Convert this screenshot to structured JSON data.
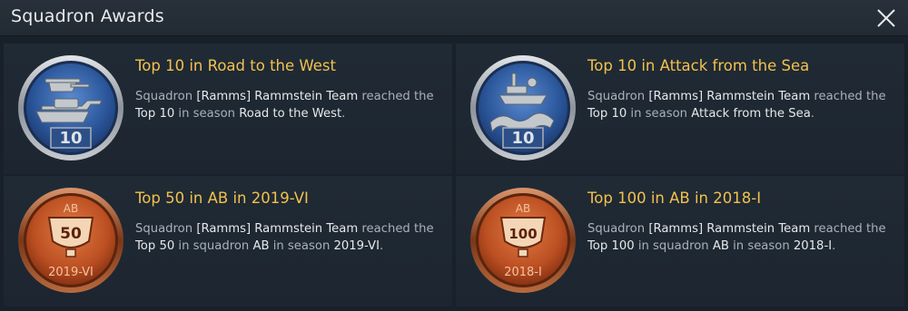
{
  "window": {
    "title": "Squadron Awards",
    "close_icon": "close-icon"
  },
  "awards": [
    {
      "title": "Top 10 in Road to the West",
      "medal": {
        "type": "blue",
        "number": "10",
        "icon": "tank-helicopter-icon"
      },
      "line1": {
        "pre": "Squadron ",
        "squad": "[Ramms] Rammstein Team",
        "post": " reached the"
      },
      "line2": {
        "pre": "Top 10",
        "mid": " in season ",
        "post": "Road to the West",
        "end": "."
      }
    },
    {
      "title": "Top 10 in Attack from the Sea",
      "medal": {
        "type": "blue",
        "number": "10",
        "icon": "ship-wave-icon"
      },
      "line1": {
        "pre": "Squadron ",
        "squad": "[Ramms] Rammstein Team",
        "post": " reached the"
      },
      "line2": {
        "pre": "Top 10",
        "mid": " in season ",
        "post": "Attack from the Sea",
        "end": "."
      }
    },
    {
      "title": "Top 50 in AB in 2019-VI",
      "medal": {
        "type": "bronze",
        "mode": "AB",
        "number": "50",
        "season": "2019-VI",
        "icon": "trophy-icon"
      },
      "line1": {
        "pre": "Squadron ",
        "squad": "[Ramms] Rammstein Team",
        "post": " reached the"
      },
      "line2": {
        "pre": "Top 50",
        "mid": " in squadron ",
        "mode": "AB",
        "mid2": " in season ",
        "post": "2019-VI",
        "end": "."
      }
    },
    {
      "title": "Top 100 in AB in 2018-I",
      "medal": {
        "type": "bronze",
        "mode": "AB",
        "number": "100",
        "season": "2018-I",
        "icon": "trophy-icon"
      },
      "line1": {
        "pre": "Squadron ",
        "squad": "[Ramms] Rammstein Team",
        "post": " reached the"
      },
      "line2": {
        "pre": "Top 100",
        "mid": " in squadron ",
        "mode": "AB",
        "mid2": " in season ",
        "post": "2018-I",
        "end": "."
      }
    }
  ],
  "colors": {
    "title_gold": "#f1c14e",
    "blue_medal": "#2f5fa8",
    "bronze_medal": "#c65a2a",
    "silver_rim": "#9ea4aa"
  }
}
